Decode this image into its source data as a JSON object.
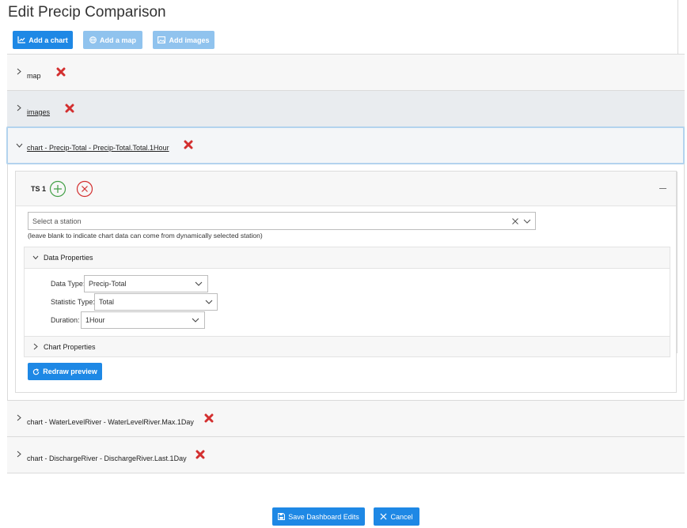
{
  "page": {
    "title": "Edit Precip Comparison"
  },
  "toolbar": {
    "add_chart": "Add a chart",
    "add_map": "Add a map",
    "add_images": "Add images"
  },
  "sections": {
    "map": "map",
    "images": "images",
    "chart_precip": "chart - Precip-Total - Precip-Total.Total.1Hour",
    "chart_water": "chart - WaterLevelRiver - WaterLevelRiver.Max.1Day",
    "chart_discharge": "chart - DischargeRiver - DischargeRiver.Last.1Day"
  },
  "ts": {
    "label": "TS 1",
    "station_placeholder": "Select a station",
    "station_hint": "(leave blank to indicate chart data can come from dynamically selected station)",
    "data_properties": "Data Properties",
    "data_type_label": "Data Type:",
    "data_type_value": "Precip-Total",
    "statistic_type_label": "Statistic Type:",
    "statistic_type_value": "Total",
    "duration_label": "Duration:",
    "duration_value": "1Hour",
    "chart_properties": "Chart Properties",
    "redraw": "Redraw preview"
  },
  "footer": {
    "save": "Save Dashboard Edits",
    "cancel": "Cancel"
  },
  "colors": {
    "primary": "#1e88e5",
    "primary_disabled": "#90c3ee",
    "delete_red": "#d32f2f",
    "add_green": "#43a047"
  }
}
